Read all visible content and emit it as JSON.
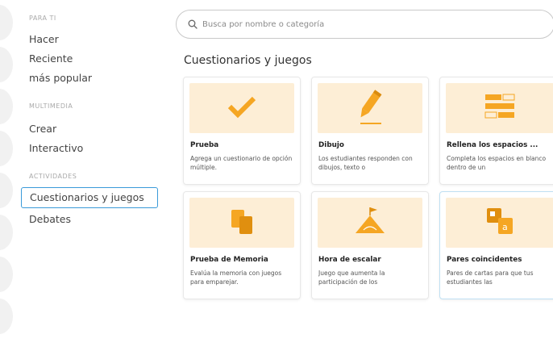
{
  "sidebar": {
    "sections": [
      {
        "title": "PARA TI",
        "items": [
          "Hacer",
          "Reciente",
          "más popular"
        ]
      },
      {
        "title": "MULTIMEDIA",
        "items": [
          "Crear",
          "Interactivo"
        ]
      },
      {
        "title": "ACTIVIDADES",
        "items": [
          "Cuestionarios y juegos",
          "Debates"
        ]
      }
    ],
    "active_item": "Cuestionarios y juegos"
  },
  "search": {
    "placeholder": "Busca por nombre o categoría"
  },
  "main": {
    "section_title": "Cuestionarios y juegos",
    "cards": [
      {
        "title": "Prueba",
        "description": "Agrega un cuestionario de opción múltiple.",
        "icon": "checkmark-icon"
      },
      {
        "title": "Dibujo",
        "description": "Los estudiantes responden con dibujos, texto o",
        "icon": "pencil-icon"
      },
      {
        "title": "Rellena los espacios ...",
        "description": "Completa los espacios en blanco dentro de un",
        "icon": "fill-blank-icon"
      },
      {
        "title": "Prueba de Memoria",
        "description": "Evalúa la memoria con juegos para emparejar.",
        "icon": "memory-cards-icon"
      },
      {
        "title": "Hora de escalar",
        "description": "Juego que aumenta la participación de los",
        "icon": "mountain-flag-icon"
      },
      {
        "title": "Pares coincidentes",
        "description": "Pares de cartas para que tus estudiantes las",
        "icon": "matching-pairs-icon"
      }
    ]
  },
  "colors": {
    "accent": "#f5a623",
    "thumb_bg": "#fdeed6",
    "active_border": "#3a9ad9"
  }
}
